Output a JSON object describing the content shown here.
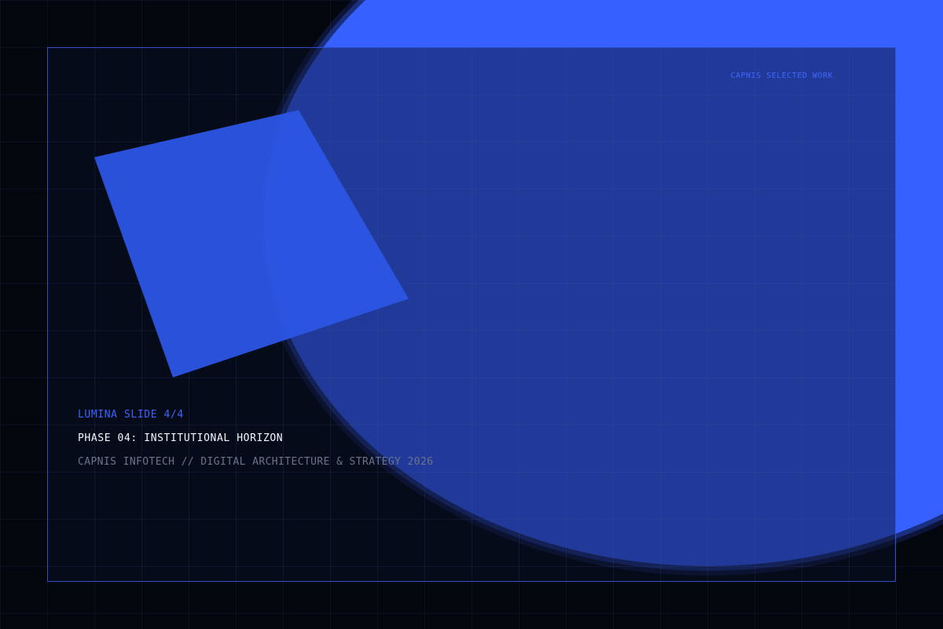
{
  "slide": {
    "label": "LUMINA SLIDE 4/4",
    "title": "PHASE 04: INSTITUTIONAL HORIZON",
    "subtitle": "CAPNIS INFOTECH // DIGITAL ARCHITECTURE & STRATEGY 2026"
  },
  "header": {
    "tag": "CAPNIS SELECTED WORK"
  },
  "colors": {
    "background": "#03060d",
    "accent": "#3660ff",
    "frame_border": "#2f4fc7",
    "label": "#3b63ff",
    "title": "#f4f7ff",
    "subtitle": "#6c738a"
  }
}
